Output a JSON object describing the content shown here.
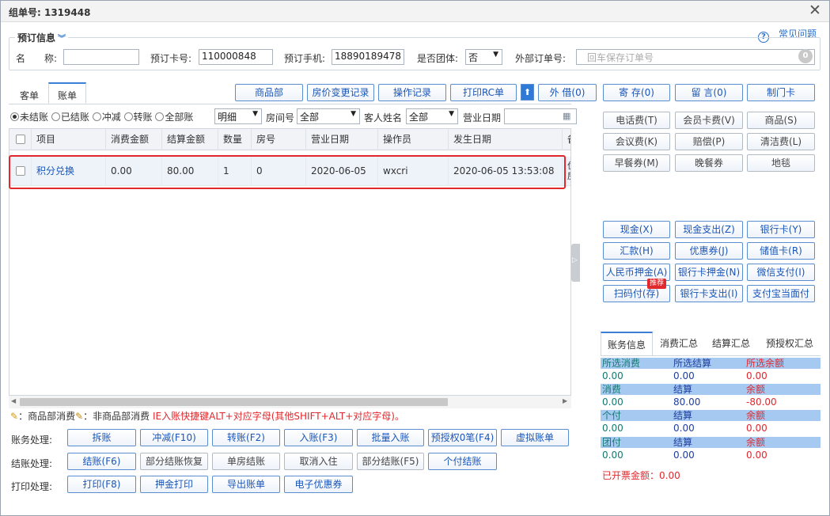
{
  "window": {
    "title": "组单号: 1319448",
    "close": "✕"
  },
  "help": {
    "icon": "?",
    "label": "常见问题"
  },
  "booking": {
    "legend": "预订信息",
    "legend_arrow": "︾",
    "name_label": "名　　称:",
    "name_value": "",
    "card_label": "预订卡号:",
    "card_value": "110000848",
    "phone_label": "预订手机:",
    "phone_value": "18890189478",
    "group_label": "是否团体:",
    "group_value": "否",
    "ext_order_label": "外部订单号:",
    "ext_order_placeholder": "回车保存订单号",
    "ext_order_badge": "0"
  },
  "tabs": [
    {
      "label": "客单"
    },
    {
      "label": "账单"
    }
  ],
  "top_buttons": [
    {
      "label": "商品部"
    },
    {
      "label": "房价变更记录"
    },
    {
      "label": "操作记录"
    },
    {
      "label": "打印RC单"
    },
    {
      "label": "外 借(0)"
    },
    {
      "label": "寄 存(0)"
    },
    {
      "label": "留 言(0)"
    },
    {
      "label": "制门卡"
    }
  ],
  "filters": {
    "radios": [
      "未结账",
      "已结账",
      "冲减",
      "转账",
      "全部账"
    ],
    "selected_radio": "未结账",
    "detail_value": "明细",
    "room_label": "房间号",
    "room_value": "全部",
    "guest_label": "客人姓名",
    "guest_value": "全部",
    "biz_date_label": "营业日期",
    "biz_date_value": ""
  },
  "table": {
    "headers": [
      "项目",
      "消费金额",
      "结算金额",
      "数量",
      "房号",
      "营业日期",
      "操作员",
      "发生日期",
      "备"
    ],
    "rows": [
      {
        "item": "积分兑换",
        "consume": "0.00",
        "settle": "80.00",
        "qty": "1",
        "room": "0",
        "biz_date": "2020-06-05",
        "operator": "wxcri",
        "occur": "2020-06-05 13:53:08",
        "extra": "优房"
      }
    ]
  },
  "legend_line": {
    "part1": "：商品部消费",
    "part2": "：非商品部消费",
    "red": "IE入账快捷键ALT+对应字母(其他SHIFT+ALT+对应字母)。"
  },
  "process": {
    "account_label": "账务处理:",
    "account_buttons": [
      "拆账",
      "冲减(F10)",
      "转账(F2)",
      "入账(F3)",
      "批量入账",
      "预授权0笔(F4)",
      "虚拟账单"
    ],
    "settle_label": "结账处理:",
    "settle_buttons": [
      "结账(F6)",
      "部分结账恢复",
      "单房结账",
      "取消入住",
      "部分结账(F5)",
      "个付结账"
    ],
    "print_label": "打印处理:",
    "print_buttons": [
      "打印(F8)",
      "押金打印",
      "导出账单",
      "电子优惠券"
    ]
  },
  "fee_buttons": [
    "电话费(T)",
    "会员卡费(V)",
    "商品(S)",
    "会议费(K)",
    "赔偿(P)",
    "清洁费(L)",
    "早餐券(M)",
    "晚餐券",
    "地毯"
  ],
  "pay_buttons": [
    "现金(X)",
    "现金支出(Z)",
    "银行卡(Y)",
    "汇款(H)",
    "优惠券(J)",
    "储值卡(R)",
    "人民币押金(A)",
    "银行卡押金(N)",
    "微信支付(I)",
    "扫码付(存)",
    "银行卡支出(I)",
    "支付宝当面付"
  ],
  "recommend_tag": "推荐",
  "account_info": {
    "tabs": [
      "账务信息",
      "消费汇总",
      "结算汇总",
      "预授权汇总"
    ],
    "groups": [
      {
        "h": [
          "所选消费",
          "所选结算",
          "所选余额"
        ],
        "v": [
          "0.00",
          "0.00",
          "0.00"
        ]
      },
      {
        "h": [
          "消费",
          "结算",
          "余额"
        ],
        "v": [
          "0.00",
          "80.00",
          "-80.00"
        ]
      },
      {
        "h": [
          "个付",
          "结算",
          "余额"
        ],
        "v": [
          "0.00",
          "0.00",
          "0.00"
        ]
      },
      {
        "h": [
          "团付",
          "结算",
          "余额"
        ],
        "v": [
          "0.00",
          "0.00",
          "0.00"
        ]
      }
    ],
    "invoiced": "已开票金额：0.00"
  },
  "colors": {
    "accent": "#3a7fd5",
    "link": "#1a56b8",
    "alert": "#e1282d",
    "bar": "#a6c9f2"
  }
}
